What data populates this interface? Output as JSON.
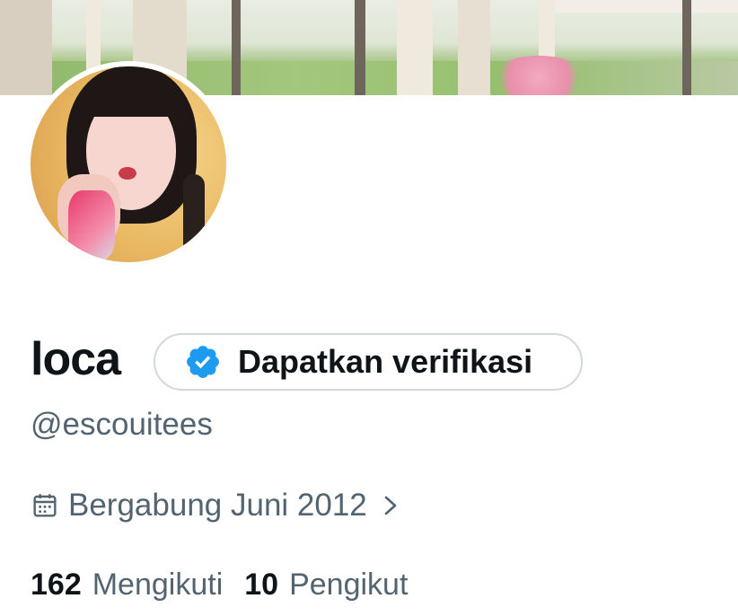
{
  "profile": {
    "display_name": "loca",
    "handle": "@escouitees",
    "verify_button_label": "Dapatkan verifikasi",
    "joined": "Bergabung Juni 2012"
  },
  "stats": {
    "following_count": "162",
    "following_label": "Mengikuti",
    "followers_count": "10",
    "followers_label": "Pengikut"
  },
  "icons": {
    "verified_badge": "verified-badge-icon",
    "calendar": "calendar-icon",
    "chevron": "chevron-right-icon"
  },
  "colors": {
    "verified_blue": "#1d9bf0",
    "text_primary": "#0f1419",
    "text_secondary": "#536471",
    "border": "#cfd9de"
  }
}
